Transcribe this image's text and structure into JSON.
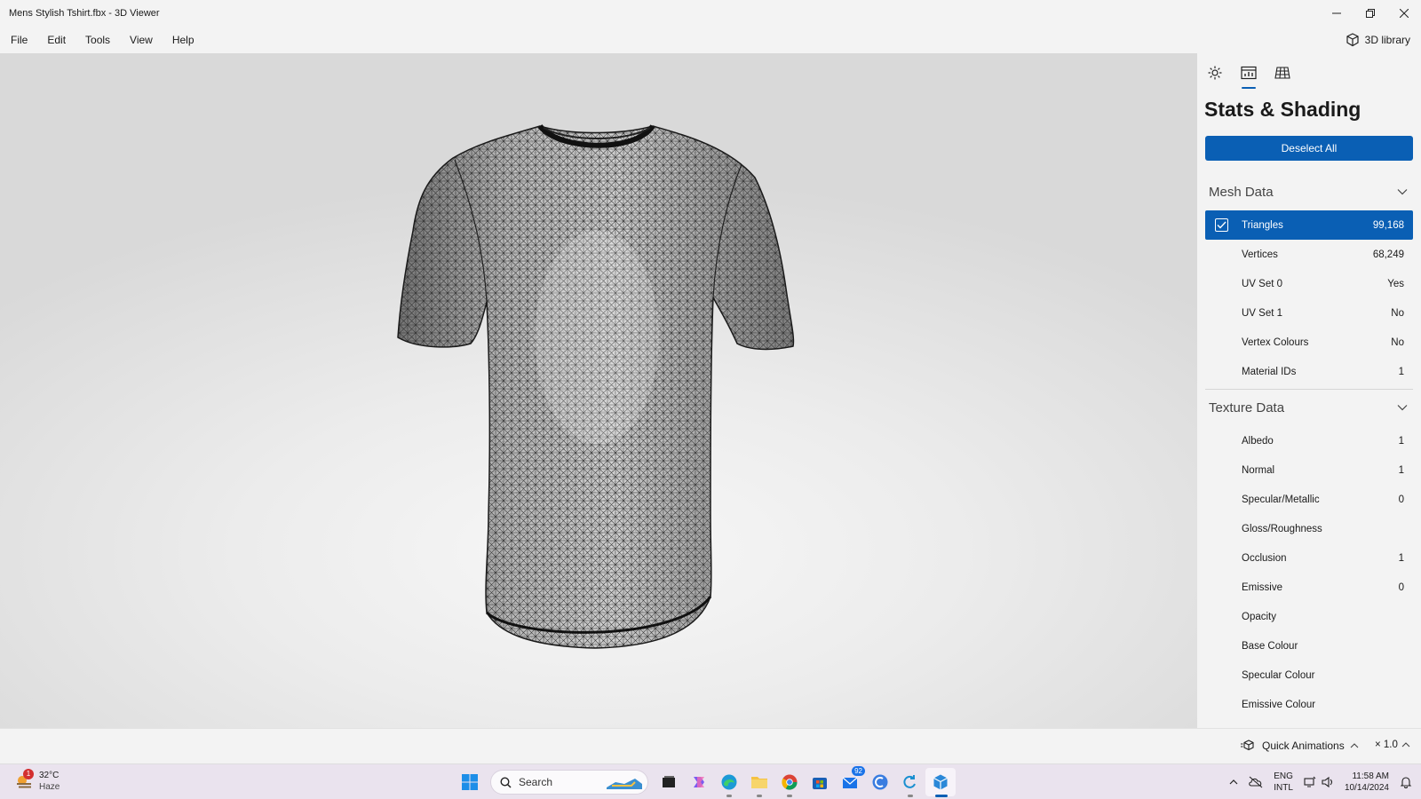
{
  "window": {
    "title": "Mens Stylish Tshirt.fbx - 3D Viewer",
    "controls": [
      "minimize-icon",
      "restore-icon",
      "close-icon"
    ]
  },
  "menu": {
    "items": [
      "File",
      "Edit",
      "Tools",
      "View",
      "Help"
    ],
    "library_label": "3D library"
  },
  "panel": {
    "tabs": [
      "sun-icon",
      "stats-icon",
      "grid-icon"
    ],
    "active_tab": 1,
    "title": "Stats & Shading",
    "deselect_label": "Deselect All",
    "mesh_section": {
      "title": "Mesh Data",
      "rows": [
        {
          "label": "Triangles",
          "value": "99,168",
          "selected": true
        },
        {
          "label": "Vertices",
          "value": "68,249"
        },
        {
          "label": "UV Set 0",
          "value": "Yes"
        },
        {
          "label": "UV Set 1",
          "value": "No"
        },
        {
          "label": "Vertex Colours",
          "value": "No"
        },
        {
          "label": "Material IDs",
          "value": "1"
        }
      ]
    },
    "texture_section": {
      "title": "Texture Data",
      "rows": [
        {
          "label": "Albedo",
          "value": "1"
        },
        {
          "label": "Normal",
          "value": "1"
        },
        {
          "label": "Specular/Metallic",
          "value": "0"
        },
        {
          "label": "Gloss/Roughness",
          "value": ""
        },
        {
          "label": "Occlusion",
          "value": "1"
        },
        {
          "label": "Emissive",
          "value": "0"
        },
        {
          "label": "Opacity",
          "value": ""
        },
        {
          "label": "Base Colour",
          "value": ""
        },
        {
          "label": "Specular Colour",
          "value": ""
        },
        {
          "label": "Emissive Colour",
          "value": ""
        }
      ]
    }
  },
  "status": {
    "quick_animations": "Quick Animations",
    "speed": "× 1.0"
  },
  "taskbar": {
    "weather_temp": "32°C",
    "weather_desc": "Haze",
    "weather_badge": "1",
    "search_placeholder": "Search",
    "mail_badge": "92",
    "lang_top": "ENG",
    "lang_bottom": "INTL",
    "time": "11:58 AM",
    "date": "10/14/2024"
  },
  "colors": {
    "accent": "#0a5fb4",
    "panel_bg": "#f3f3f3",
    "taskbar_bg": "#eae3ee"
  }
}
